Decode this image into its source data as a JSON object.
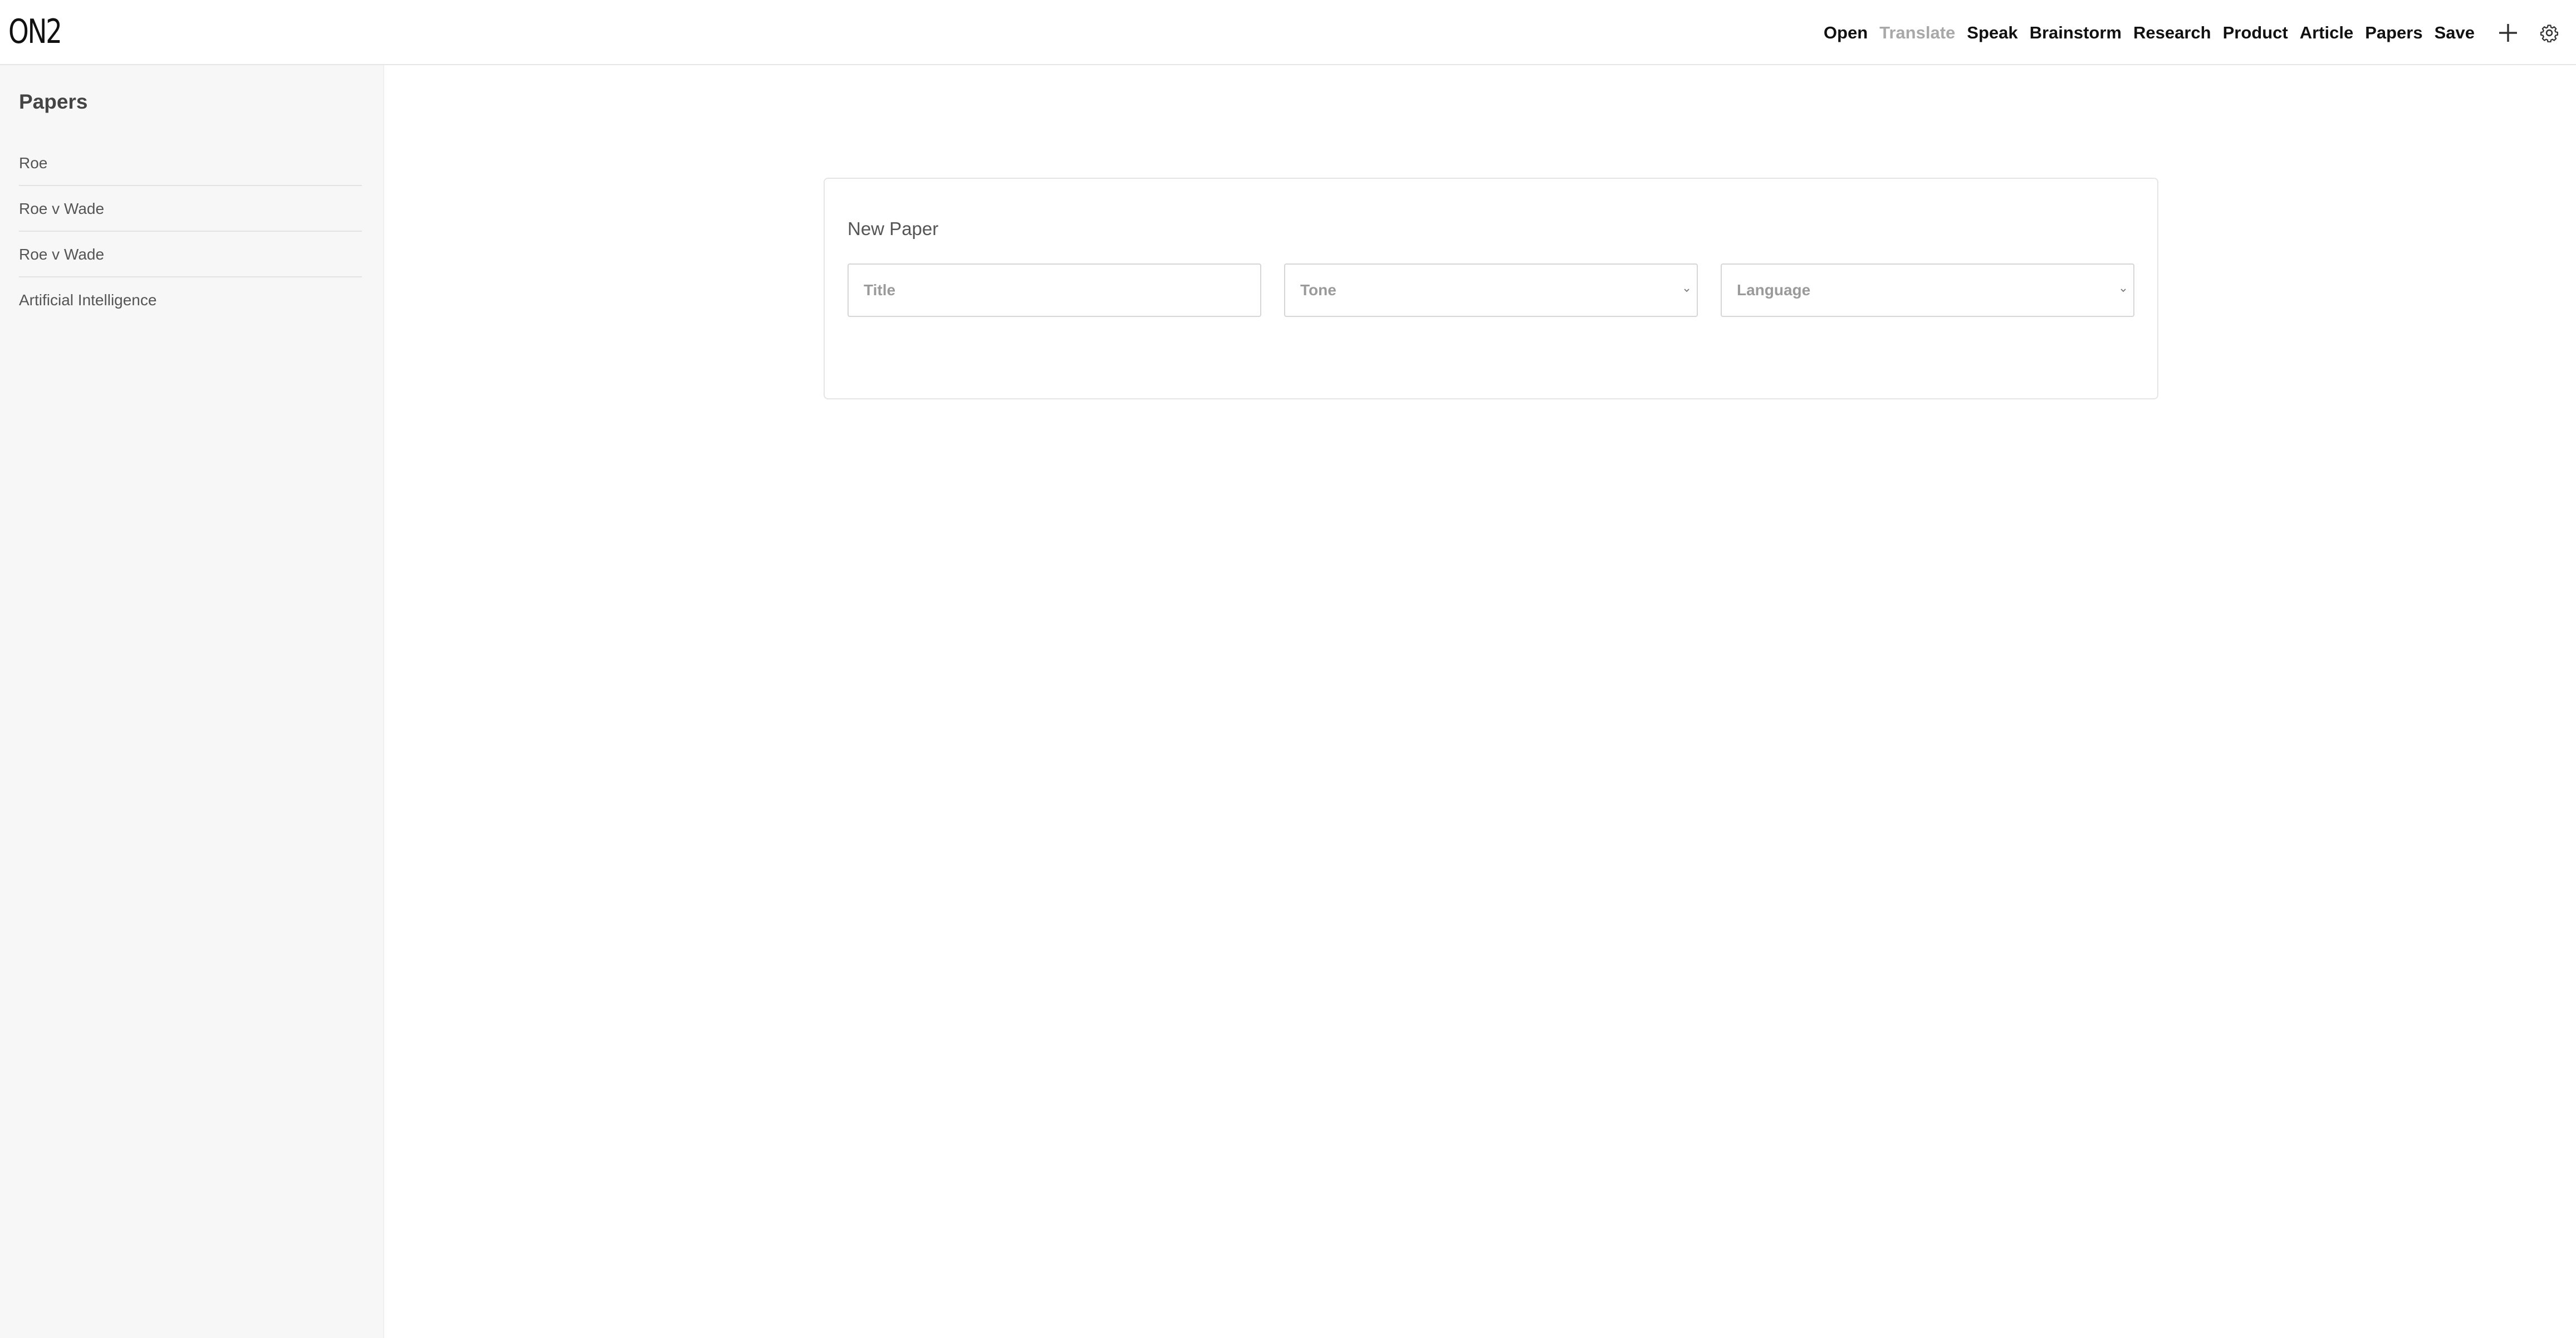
{
  "app": {
    "logo_text": "ON2"
  },
  "nav": {
    "items": [
      {
        "label": "Open",
        "disabled": false
      },
      {
        "label": "Translate",
        "disabled": true
      },
      {
        "label": "Speak",
        "disabled": false
      },
      {
        "label": "Brainstorm",
        "disabled": false
      },
      {
        "label": "Research",
        "disabled": false
      },
      {
        "label": "Product",
        "disabled": false
      },
      {
        "label": "Article",
        "disabled": false
      },
      {
        "label": "Papers",
        "disabled": false
      },
      {
        "label": "Save",
        "disabled": false
      }
    ],
    "icons": [
      "plus-icon",
      "gear-icon"
    ]
  },
  "sidebar": {
    "title": "Papers",
    "items": [
      {
        "label": "Roe"
      },
      {
        "label": "Roe v Wade"
      },
      {
        "label": "Roe v Wade"
      },
      {
        "label": "Artificial Intelligence"
      }
    ]
  },
  "form": {
    "title": "New Paper",
    "title_field": {
      "placeholder": "Title",
      "value": ""
    },
    "tone_select": {
      "selected": "Tone"
    },
    "language_select": {
      "selected": "Language"
    }
  },
  "colors": {
    "sidebar_bg": "#f7f7f7",
    "disabled_nav": "#a8a8a8",
    "text": "#111111"
  }
}
